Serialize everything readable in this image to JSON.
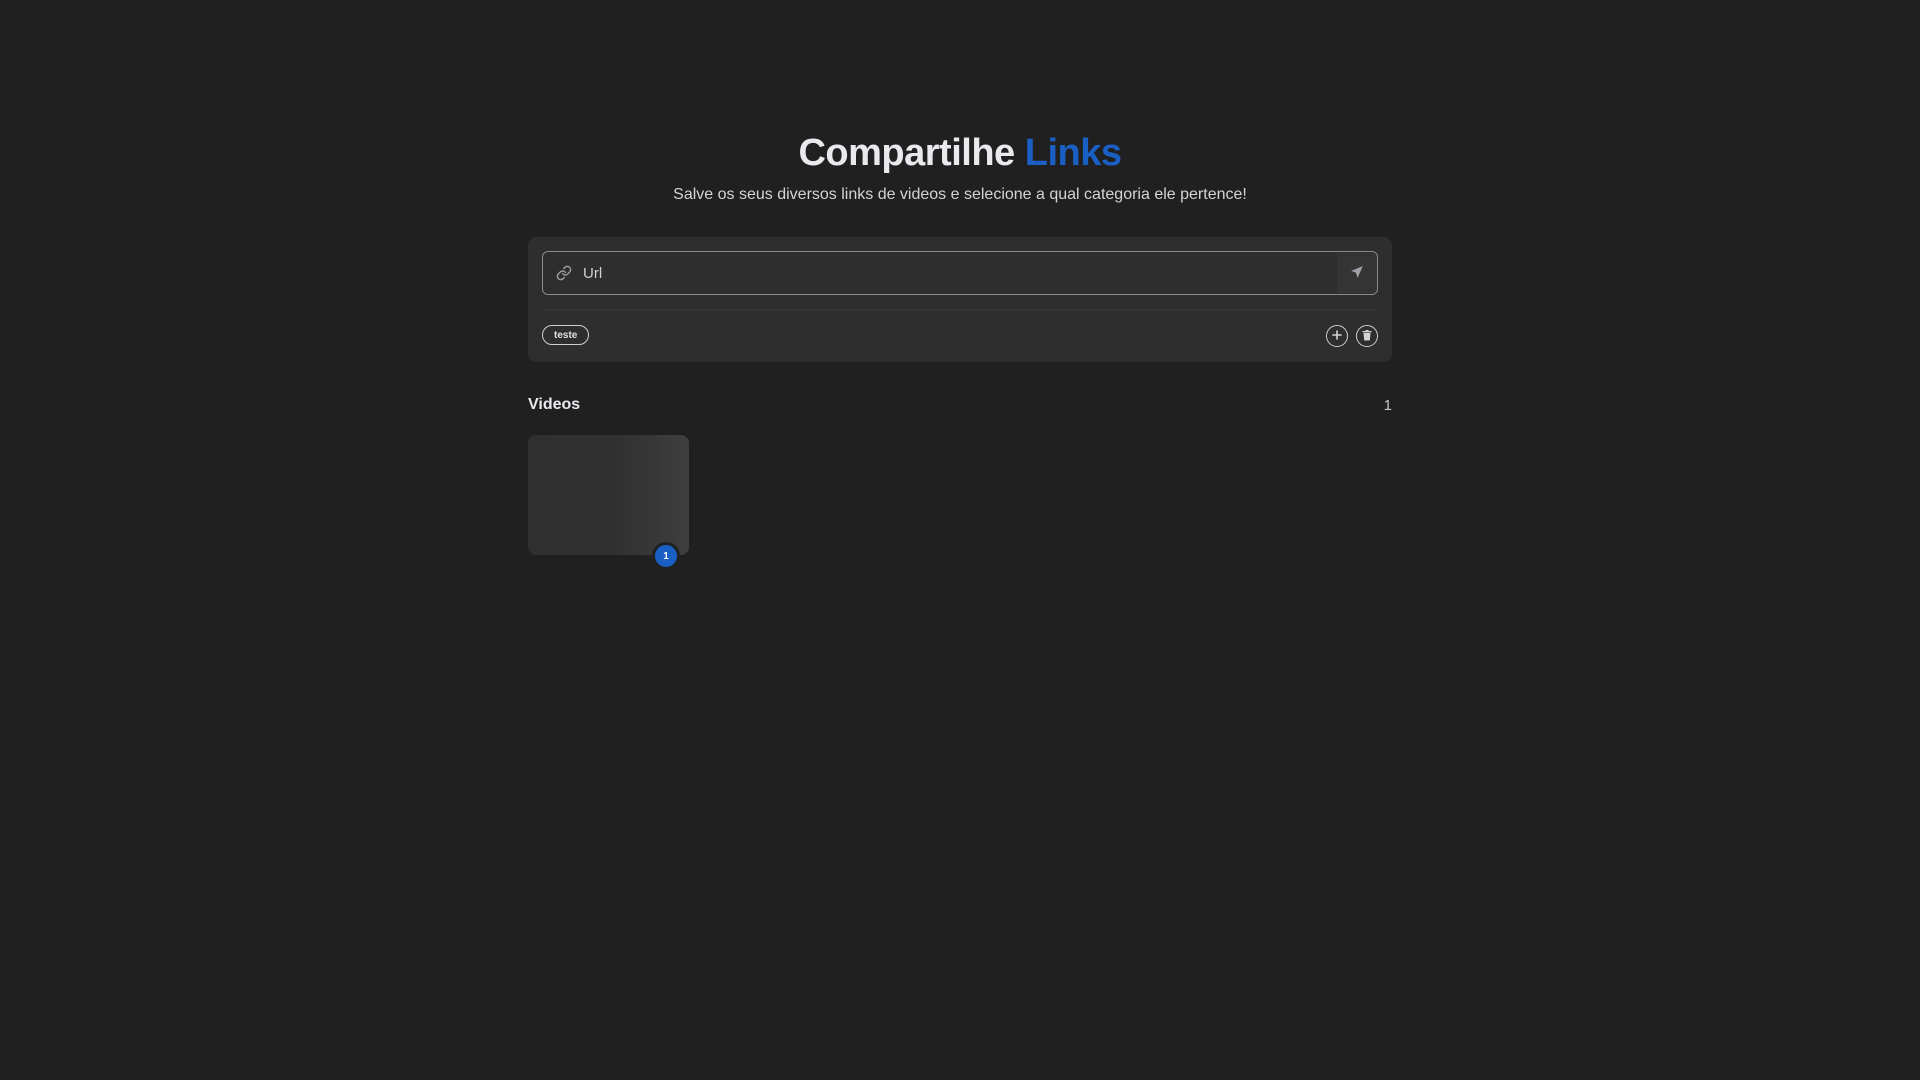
{
  "header": {
    "title_main": "Compartilhe",
    "title_accent": "Links",
    "subtitle": "Salve os seus diversos links de videos e selecione a qual categoria ele pertence!"
  },
  "form": {
    "url_placeholder": "Url",
    "link_icon": "link-icon",
    "send_icon": "send-icon"
  },
  "categories": {
    "tags": [
      "teste"
    ],
    "add_icon": "plus-circle-icon",
    "delete_icon": "trash-icon"
  },
  "videos": {
    "section_title": "Videos",
    "count": "1",
    "items": [
      {
        "badge": "1"
      }
    ]
  },
  "colors": {
    "background": "#202020",
    "card": "#2e2e2e",
    "accent": "#1a5fc4",
    "text": "#e1e1e6"
  }
}
